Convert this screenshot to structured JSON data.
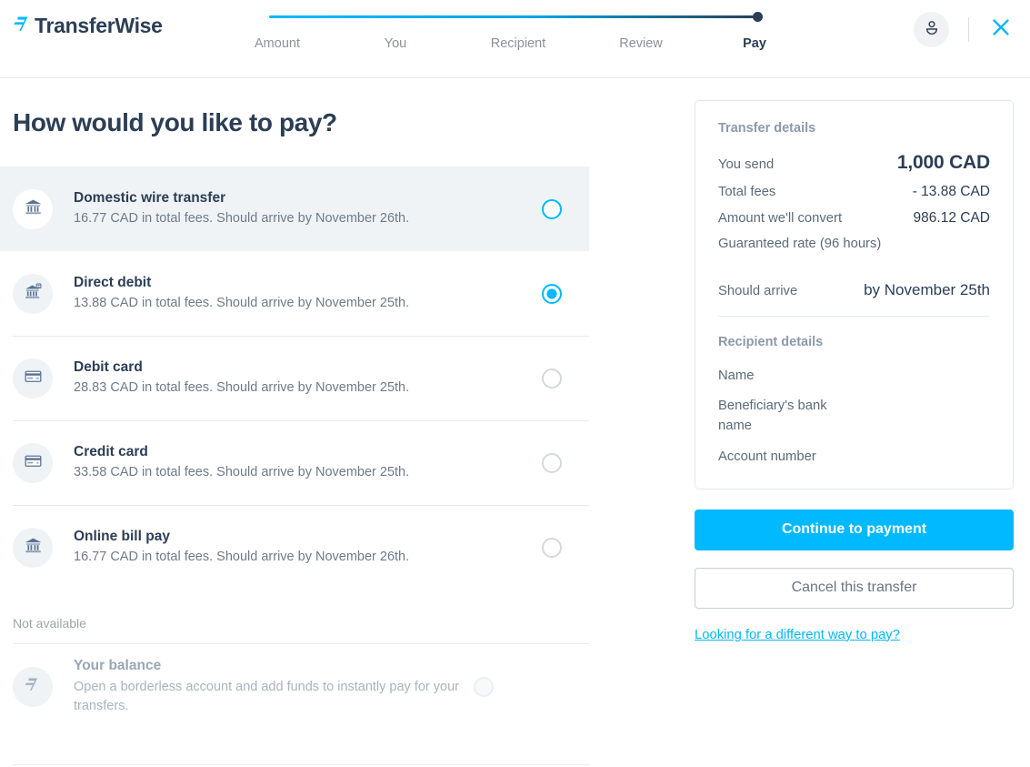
{
  "brand": {
    "name": "TransferWise",
    "logo_icon": "transferwise-flag-icon"
  },
  "header": {
    "steps": [
      {
        "label": "Amount",
        "active": false
      },
      {
        "label": "You",
        "active": false
      },
      {
        "label": "Recipient",
        "active": false
      },
      {
        "label": "Review",
        "active": false
      },
      {
        "label": "Pay",
        "active": true
      }
    ],
    "avatar_icon": "user-avatar-icon",
    "close_icon": "close-x-icon",
    "progress_percent": 100,
    "accent_color": "#00b9ff",
    "track_end_color": "#2b3e55"
  },
  "main": {
    "title": "How would you like to pay?",
    "not_available_label": "Not available",
    "methods": [
      {
        "title": "Domestic wire transfer",
        "subtitle": "16.77 CAD in total fees. Should arrive by November 26th.",
        "icon": "bank-building-icon",
        "selected": false,
        "highlighted": true,
        "disabled": false
      },
      {
        "title": "Direct debit",
        "subtitle": "13.88 CAD in total fees. Should arrive by November 25th.",
        "icon": "bank-direct-debit-icon",
        "selected": true,
        "highlighted": false,
        "disabled": false
      },
      {
        "title": "Debit card",
        "subtitle": "28.83 CAD in total fees. Should arrive by November 25th.",
        "icon": "debit-card-icon",
        "selected": false,
        "highlighted": false,
        "disabled": false
      },
      {
        "title": "Credit card",
        "subtitle": "33.58 CAD in total fees. Should arrive by November 25th.",
        "icon": "credit-card-icon",
        "selected": false,
        "highlighted": false,
        "disabled": false
      },
      {
        "title": "Online bill pay",
        "subtitle": "16.77 CAD in total fees. Should arrive by November 26th.",
        "icon": "bank-building-icon",
        "selected": false,
        "highlighted": false,
        "disabled": false
      }
    ],
    "unavailable_methods": [
      {
        "title": "Your balance",
        "subtitle": "Open a borderless account and add funds to instantly pay for your transfers.",
        "icon": "transferwise-flag-icon",
        "selected": false,
        "disabled": true
      }
    ]
  },
  "sidebar": {
    "transfer_details_heading": "Transfer details",
    "rows": [
      {
        "label": "You send",
        "value": "1,000 CAD"
      },
      {
        "label": "Total fees",
        "value": "- 13.88 CAD"
      },
      {
        "label": "Amount we'll convert",
        "value": "986.12 CAD"
      },
      {
        "label": "Guaranteed rate (96 hours)",
        "value": ""
      }
    ],
    "arrive_label": "Should arrive",
    "arrive_value": "by November 25th",
    "recipient_details_heading": "Recipient details",
    "recipient_rows": [
      {
        "label": "Name"
      },
      {
        "label": "Beneficiary's bank name"
      },
      {
        "label": "Account number"
      }
    ],
    "continue_button": "Continue to payment",
    "cancel_button": "Cancel this transfer",
    "alt_link": "Looking for a different way to pay?"
  }
}
